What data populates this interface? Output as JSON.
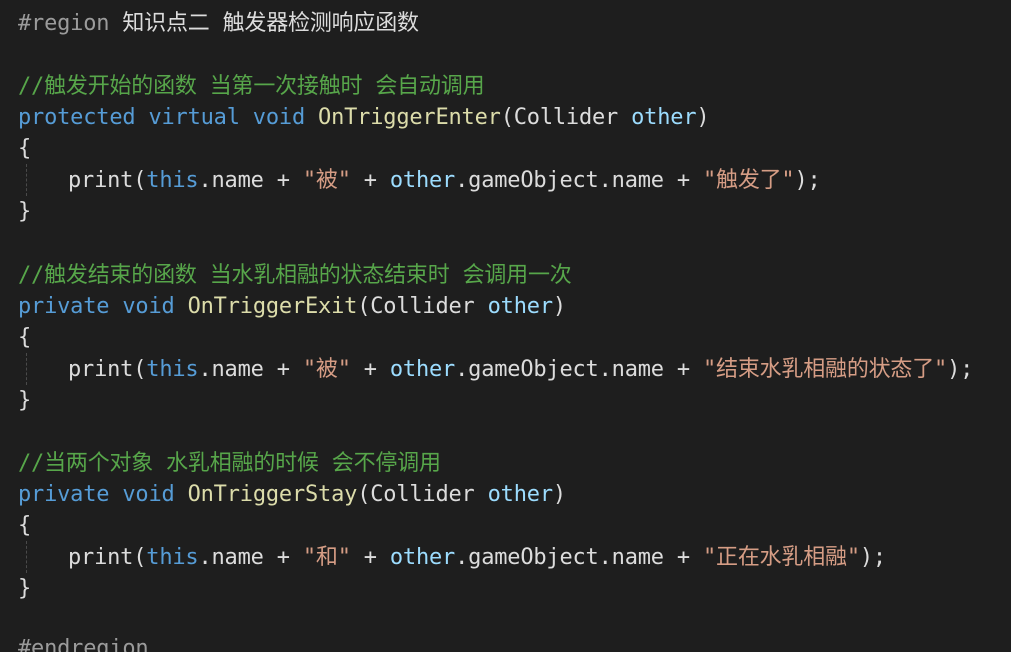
{
  "editor": {
    "region_start": {
      "directive": "#region",
      "title": " 知识点二 触发器检测响应函数"
    },
    "blocks": [
      {
        "comment": "//触发开始的函数 当第一次接触时 会自动调用",
        "modifiers": "protected virtual void",
        "method": "OnTriggerEnter",
        "param_type": "(Collider ",
        "param_name": "other",
        "param_close": ")",
        "open_brace": "{",
        "close_brace": "}",
        "body": {
          "call": "print(",
          "this": "this",
          "part1": ".name + ",
          "str1": "\"被\"",
          "part2": " + ",
          "other": "other",
          "part3": ".gameObject.name + ",
          "str2": "\"触发了\"",
          "end": ");"
        }
      },
      {
        "comment": "//触发结束的函数 当水乳相融的状态结束时 会调用一次",
        "modifiers": "private void",
        "method": "OnTriggerExit",
        "param_type": "(Collider ",
        "param_name": "other",
        "param_close": ")",
        "open_brace": "{",
        "close_brace": "}",
        "body": {
          "call": "print(",
          "this": "this",
          "part1": ".name + ",
          "str1": "\"被\"",
          "part2": " + ",
          "other": "other",
          "part3": ".gameObject.name + ",
          "str2": "\"结束水乳相融的状态了\"",
          "end": ");"
        }
      },
      {
        "comment": "//当两个对象 水乳相融的时候 会不停调用",
        "modifiers": "private void",
        "method": "OnTriggerStay",
        "param_type": "(Collider ",
        "param_name": "other",
        "param_close": ")",
        "open_brace": "{",
        "close_brace": "}",
        "body": {
          "call": "print(",
          "this": "this",
          "part1": ".name + ",
          "str1": "\"和\"",
          "part2": " + ",
          "other": "other",
          "part3": ".gameObject.name + ",
          "str2": "\"正在水乳相融\"",
          "end": ");"
        }
      }
    ],
    "region_end": "#endregion"
  }
}
